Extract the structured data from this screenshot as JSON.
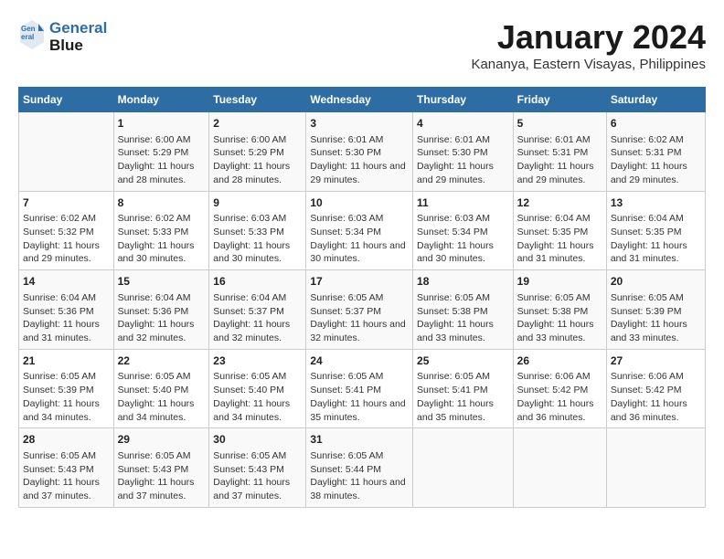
{
  "logo": {
    "line1": "General",
    "line2": "Blue"
  },
  "title": "January 2024",
  "subtitle": "Kananya, Eastern Visayas, Philippines",
  "headers": [
    "Sunday",
    "Monday",
    "Tuesday",
    "Wednesday",
    "Thursday",
    "Friday",
    "Saturday"
  ],
  "weeks": [
    [
      {
        "day": "",
        "sunrise": "",
        "sunset": "",
        "daylight": ""
      },
      {
        "day": "1",
        "sunrise": "Sunrise: 6:00 AM",
        "sunset": "Sunset: 5:29 PM",
        "daylight": "Daylight: 11 hours and 28 minutes."
      },
      {
        "day": "2",
        "sunrise": "Sunrise: 6:00 AM",
        "sunset": "Sunset: 5:29 PM",
        "daylight": "Daylight: 11 hours and 28 minutes."
      },
      {
        "day": "3",
        "sunrise": "Sunrise: 6:01 AM",
        "sunset": "Sunset: 5:30 PM",
        "daylight": "Daylight: 11 hours and 29 minutes."
      },
      {
        "day": "4",
        "sunrise": "Sunrise: 6:01 AM",
        "sunset": "Sunset: 5:30 PM",
        "daylight": "Daylight: 11 hours and 29 minutes."
      },
      {
        "day": "5",
        "sunrise": "Sunrise: 6:01 AM",
        "sunset": "Sunset: 5:31 PM",
        "daylight": "Daylight: 11 hours and 29 minutes."
      },
      {
        "day": "6",
        "sunrise": "Sunrise: 6:02 AM",
        "sunset": "Sunset: 5:31 PM",
        "daylight": "Daylight: 11 hours and 29 minutes."
      }
    ],
    [
      {
        "day": "7",
        "sunrise": "Sunrise: 6:02 AM",
        "sunset": "Sunset: 5:32 PM",
        "daylight": "Daylight: 11 hours and 29 minutes."
      },
      {
        "day": "8",
        "sunrise": "Sunrise: 6:02 AM",
        "sunset": "Sunset: 5:33 PM",
        "daylight": "Daylight: 11 hours and 30 minutes."
      },
      {
        "day": "9",
        "sunrise": "Sunrise: 6:03 AM",
        "sunset": "Sunset: 5:33 PM",
        "daylight": "Daylight: 11 hours and 30 minutes."
      },
      {
        "day": "10",
        "sunrise": "Sunrise: 6:03 AM",
        "sunset": "Sunset: 5:34 PM",
        "daylight": "Daylight: 11 hours and 30 minutes."
      },
      {
        "day": "11",
        "sunrise": "Sunrise: 6:03 AM",
        "sunset": "Sunset: 5:34 PM",
        "daylight": "Daylight: 11 hours and 30 minutes."
      },
      {
        "day": "12",
        "sunrise": "Sunrise: 6:04 AM",
        "sunset": "Sunset: 5:35 PM",
        "daylight": "Daylight: 11 hours and 31 minutes."
      },
      {
        "day": "13",
        "sunrise": "Sunrise: 6:04 AM",
        "sunset": "Sunset: 5:35 PM",
        "daylight": "Daylight: 11 hours and 31 minutes."
      }
    ],
    [
      {
        "day": "14",
        "sunrise": "Sunrise: 6:04 AM",
        "sunset": "Sunset: 5:36 PM",
        "daylight": "Daylight: 11 hours and 31 minutes."
      },
      {
        "day": "15",
        "sunrise": "Sunrise: 6:04 AM",
        "sunset": "Sunset: 5:36 PM",
        "daylight": "Daylight: 11 hours and 32 minutes."
      },
      {
        "day": "16",
        "sunrise": "Sunrise: 6:04 AM",
        "sunset": "Sunset: 5:37 PM",
        "daylight": "Daylight: 11 hours and 32 minutes."
      },
      {
        "day": "17",
        "sunrise": "Sunrise: 6:05 AM",
        "sunset": "Sunset: 5:37 PM",
        "daylight": "Daylight: 11 hours and 32 minutes."
      },
      {
        "day": "18",
        "sunrise": "Sunrise: 6:05 AM",
        "sunset": "Sunset: 5:38 PM",
        "daylight": "Daylight: 11 hours and 33 minutes."
      },
      {
        "day": "19",
        "sunrise": "Sunrise: 6:05 AM",
        "sunset": "Sunset: 5:38 PM",
        "daylight": "Daylight: 11 hours and 33 minutes."
      },
      {
        "day": "20",
        "sunrise": "Sunrise: 6:05 AM",
        "sunset": "Sunset: 5:39 PM",
        "daylight": "Daylight: 11 hours and 33 minutes."
      }
    ],
    [
      {
        "day": "21",
        "sunrise": "Sunrise: 6:05 AM",
        "sunset": "Sunset: 5:39 PM",
        "daylight": "Daylight: 11 hours and 34 minutes."
      },
      {
        "day": "22",
        "sunrise": "Sunrise: 6:05 AM",
        "sunset": "Sunset: 5:40 PM",
        "daylight": "Daylight: 11 hours and 34 minutes."
      },
      {
        "day": "23",
        "sunrise": "Sunrise: 6:05 AM",
        "sunset": "Sunset: 5:40 PM",
        "daylight": "Daylight: 11 hours and 34 minutes."
      },
      {
        "day": "24",
        "sunrise": "Sunrise: 6:05 AM",
        "sunset": "Sunset: 5:41 PM",
        "daylight": "Daylight: 11 hours and 35 minutes."
      },
      {
        "day": "25",
        "sunrise": "Sunrise: 6:05 AM",
        "sunset": "Sunset: 5:41 PM",
        "daylight": "Daylight: 11 hours and 35 minutes."
      },
      {
        "day": "26",
        "sunrise": "Sunrise: 6:06 AM",
        "sunset": "Sunset: 5:42 PM",
        "daylight": "Daylight: 11 hours and 36 minutes."
      },
      {
        "day": "27",
        "sunrise": "Sunrise: 6:06 AM",
        "sunset": "Sunset: 5:42 PM",
        "daylight": "Daylight: 11 hours and 36 minutes."
      }
    ],
    [
      {
        "day": "28",
        "sunrise": "Sunrise: 6:05 AM",
        "sunset": "Sunset: 5:43 PM",
        "daylight": "Daylight: 11 hours and 37 minutes."
      },
      {
        "day": "29",
        "sunrise": "Sunrise: 6:05 AM",
        "sunset": "Sunset: 5:43 PM",
        "daylight": "Daylight: 11 hours and 37 minutes."
      },
      {
        "day": "30",
        "sunrise": "Sunrise: 6:05 AM",
        "sunset": "Sunset: 5:43 PM",
        "daylight": "Daylight: 11 hours and 37 minutes."
      },
      {
        "day": "31",
        "sunrise": "Sunrise: 6:05 AM",
        "sunset": "Sunset: 5:44 PM",
        "daylight": "Daylight: 11 hours and 38 minutes."
      },
      {
        "day": "",
        "sunrise": "",
        "sunset": "",
        "daylight": ""
      },
      {
        "day": "",
        "sunrise": "",
        "sunset": "",
        "daylight": ""
      },
      {
        "day": "",
        "sunrise": "",
        "sunset": "",
        "daylight": ""
      }
    ]
  ]
}
